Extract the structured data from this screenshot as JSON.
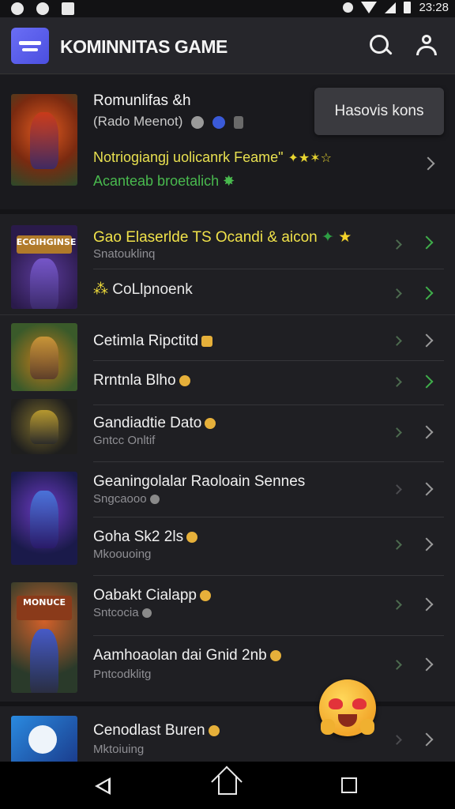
{
  "status_bar": {
    "time": "23:28"
  },
  "app_bar": {
    "title": "KOMINNITAS GAME"
  },
  "featured": {
    "title": "Romunlifas &h",
    "meta": "(Rado Meenot)",
    "notice": "Notriogiangj uolicanrk Feame\"",
    "notice_stars": "✦★✶☆",
    "subtitle": "Acanteab broetalich",
    "tooltip": "Hasovis kons"
  },
  "section1": {
    "rows": [
      {
        "title": "Gao Elaserlde TS Ocandi & aicon",
        "sub": "Snatouklinq"
      },
      {
        "title": "CoLlpnoenk",
        "sub": ""
      }
    ]
  },
  "section2": {
    "rows": [
      {
        "title": "Cetimla Ripctitd",
        "sub": ""
      },
      {
        "title": "Rrntnla Blho",
        "sub": ""
      },
      {
        "title": "Gandiadtie Dato",
        "sub": "Gntcc Onltif"
      },
      {
        "title": "Geaningolalar Raoloain Sennes",
        "sub": "Sngcaooo"
      },
      {
        "title": "Goha Sk2 2ls",
        "sub": "Mkoouoing"
      },
      {
        "title": "Oabakt Cialapp",
        "sub": "Sntcocia"
      },
      {
        "title": "Aamhoaolan dai Gnid 2nb",
        "sub": "Pntcodklitg"
      }
    ]
  },
  "section3": {
    "rows": [
      {
        "title": "Cenodlast Buren",
        "sub": "Mktoiuing"
      }
    ]
  },
  "thumbs": {
    "t1_banner": "ECGIHGINSE",
    "t5_banner": "MONUCE"
  }
}
